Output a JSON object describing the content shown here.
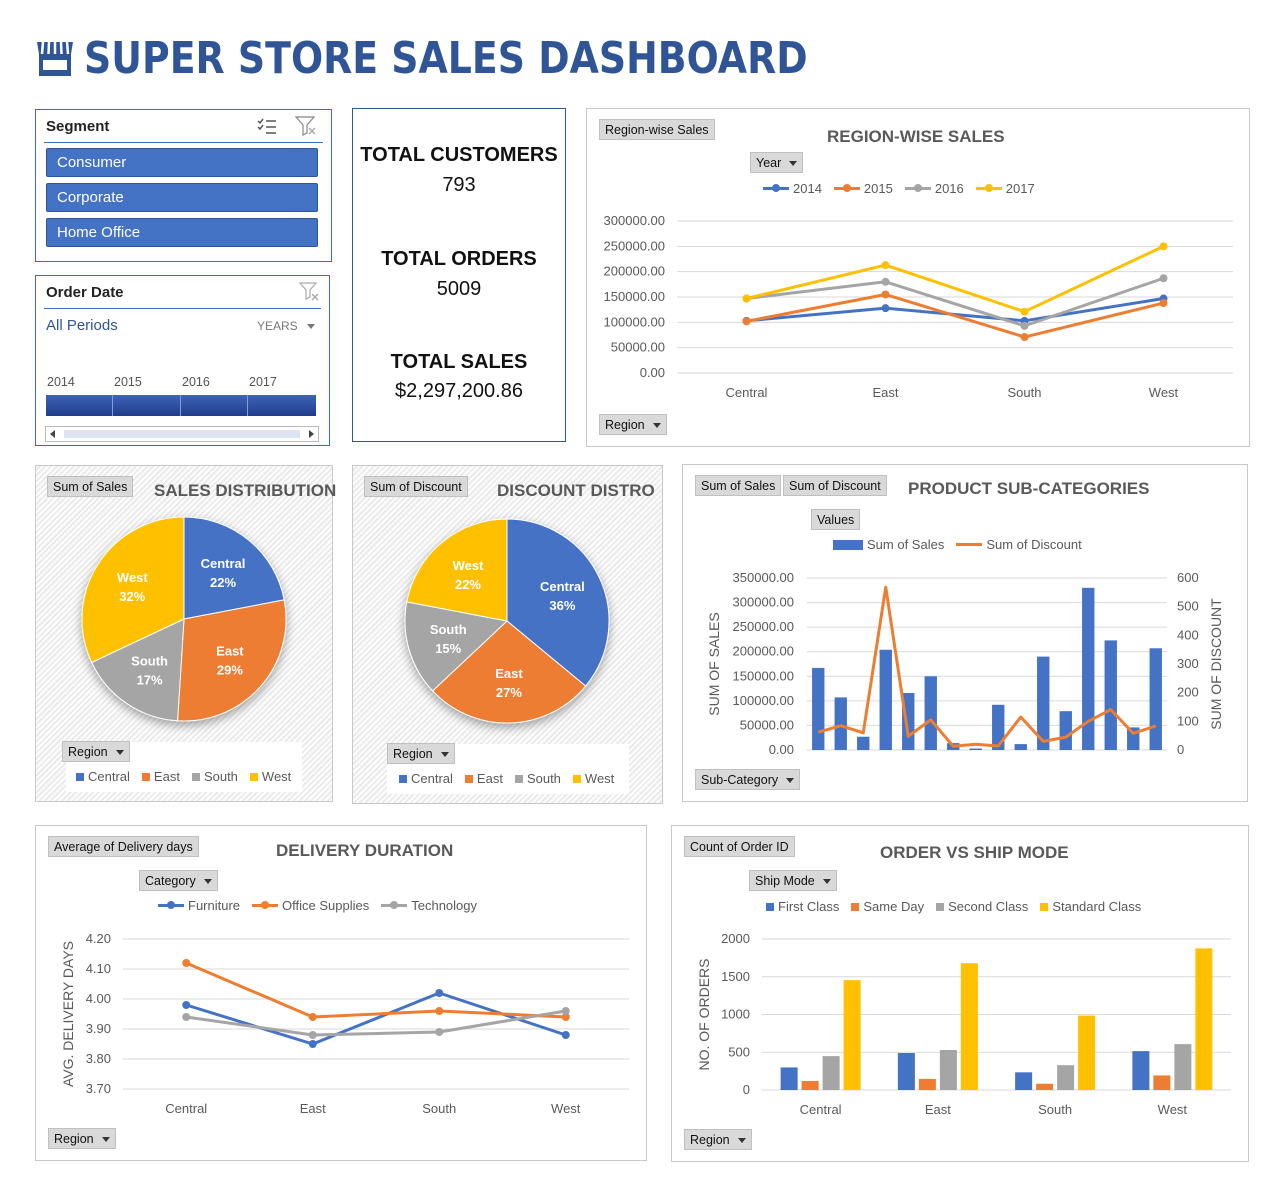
{
  "dashboard_title": "SUPER STORE SALES DASHBOARD",
  "colors": {
    "blue": "#4472c4",
    "orange": "#ed7d31",
    "gray": "#a5a5a5",
    "yellow": "#ffc000",
    "title": "#2f5597"
  },
  "segment_slicer": {
    "header": "Segment",
    "items": [
      "Consumer",
      "Corporate",
      "Home Office"
    ]
  },
  "order_date_slicer": {
    "header": "Order Date",
    "period": "All Periods",
    "level": "YEARS",
    "years": [
      "2014",
      "2015",
      "2016",
      "2017"
    ]
  },
  "kpis": {
    "customers_label": "TOTAL CUSTOMERS",
    "customers_value": "793",
    "orders_label": "TOTAL ORDERS",
    "orders_value": "5009",
    "sales_label": "TOTAL SALES",
    "sales_value": "$2,297,200.86"
  },
  "region_sales": {
    "field_value": "Region-wise Sales",
    "field_year": "Year",
    "field_region": "Region"
  },
  "sales_distribution": {
    "field_value": "Sum of Sales",
    "field_region": "Region"
  },
  "discount_distribution": {
    "field_value": "Sum of Discount",
    "field_region": "Region"
  },
  "subcategories": {
    "field_sales": "Sum of Sales",
    "field_discount": "Sum of Discount",
    "field_values": "Values",
    "field_sub": "Sub-Category"
  },
  "delivery": {
    "field_value": "Average of Delivery days",
    "field_category": "Category",
    "field_region": "Region"
  },
  "shipmode": {
    "field_value": "Count of Order ID",
    "field_ship": "Ship Mode",
    "field_region": "Region"
  },
  "chart_data": [
    {
      "id": "region",
      "type": "line",
      "title": "REGION-WISE SALES",
      "categories": [
        "Central",
        "East",
        "South",
        "West"
      ],
      "series": [
        {
          "name": "2014",
          "color": "#4472c4",
          "values": [
            103000,
            128000,
            103000,
            147000
          ]
        },
        {
          "name": "2015",
          "color": "#ed7d31",
          "values": [
            102000,
            155000,
            71000,
            138000
          ]
        },
        {
          "name": "2016",
          "color": "#a5a5a5",
          "values": [
            147000,
            180000,
            93000,
            187000
          ]
        },
        {
          "name": "2017",
          "color": "#ffc000",
          "values": [
            147000,
            213000,
            121000,
            250000
          ]
        }
      ],
      "ylim": [
        0,
        300000
      ],
      "yticks": [
        "0.00",
        "50000.00",
        "100000.00",
        "150000.00",
        "200000.00",
        "250000.00",
        "300000.00"
      ],
      "grid": true,
      "legend": "top"
    },
    {
      "id": "salesdist",
      "type": "pie",
      "title": "SALES DISTRIBUTION",
      "labels": [
        "Central",
        "East",
        "South",
        "West"
      ],
      "values": [
        22,
        29,
        17,
        32
      ],
      "value_labels": [
        "22%",
        "29%",
        "17%",
        "32%"
      ],
      "colors": [
        "#4472c4",
        "#ed7d31",
        "#a5a5a5",
        "#ffc000"
      ],
      "legend": "bottom"
    },
    {
      "id": "discdist",
      "type": "pie",
      "title": "DISCOUNT DISTRO",
      "labels": [
        "Central",
        "East",
        "South",
        "West"
      ],
      "values": [
        36,
        27,
        15,
        22
      ],
      "value_labels": [
        "36%",
        "27%",
        "15%",
        "22%"
      ],
      "colors": [
        "#4472c4",
        "#ed7d31",
        "#a5a5a5",
        "#ffc000"
      ],
      "legend": "bottom"
    },
    {
      "id": "subcat",
      "type": "bar",
      "title": "PRODUCT SUB-CATEGORIES",
      "ylabel": "SUM OF SALES",
      "y2label": "SUM OF DISCOUNT",
      "ylim": [
        0,
        350000
      ],
      "y2lim": [
        0,
        600
      ],
      "yticks": [
        "0.00",
        "50000.00",
        "100000.00",
        "150000.00",
        "200000.00",
        "250000.00",
        "300000.00",
        "350000.00"
      ],
      "y2ticks": [
        "0",
        "100",
        "200",
        "300",
        "400",
        "500",
        "600"
      ],
      "series": [
        {
          "name": "Sum of Sales",
          "color": "#4472c4",
          "kind": "bar",
          "values": [
            167000,
            107000,
            27000,
            204000,
            116000,
            150000,
            14000,
            3000,
            92000,
            12000,
            190000,
            79000,
            330000,
            223000,
            46000,
            207000
          ]
        },
        {
          "name": "Sum of Discount",
          "color": "#ed7d31",
          "kind": "line",
          "values": [
            62,
            85,
            60,
            568,
            48,
            105,
            13,
            20,
            14,
            115,
            30,
            45,
            100,
            141,
            58,
            84
          ]
        }
      ],
      "grid": true,
      "legend": "top"
    },
    {
      "id": "delivery",
      "type": "line",
      "title": "DELIVERY DURATION",
      "ylabel": "AVG. DELIVERY DAYS",
      "categories": [
        "Central",
        "East",
        "South",
        "West"
      ],
      "series": [
        {
          "name": "Furniture",
          "color": "#4472c4",
          "values": [
            3.98,
            3.85,
            4.02,
            3.88
          ]
        },
        {
          "name": "Office Supplies",
          "color": "#ed7d31",
          "values": [
            4.12,
            3.94,
            3.96,
            3.94
          ]
        },
        {
          "name": "Technology",
          "color": "#a5a5a5",
          "values": [
            3.94,
            3.88,
            3.89,
            3.96
          ]
        }
      ],
      "ylim": [
        3.7,
        4.2
      ],
      "yticks": [
        "3.70",
        "3.80",
        "3.90",
        "4.00",
        "4.10",
        "4.20"
      ],
      "grid": true,
      "legend": "top"
    },
    {
      "id": "ship",
      "type": "bar",
      "title": "ORDER VS SHIP MODE",
      "ylabel": "NO. OF ORDERS",
      "categories": [
        "Central",
        "East",
        "South",
        "West"
      ],
      "series": [
        {
          "name": "First Class",
          "color": "#4472c4",
          "values": [
            299,
            490,
            234,
            515
          ]
        },
        {
          "name": "Same Day",
          "color": "#ed7d31",
          "values": [
            120,
            147,
            83,
            193
          ]
        },
        {
          "name": "Second Class",
          "color": "#a5a5a5",
          "values": [
            449,
            530,
            329,
            608
          ]
        },
        {
          "name": "Standard Class",
          "color": "#ffc000",
          "values": [
            1455,
            1679,
            986,
            1876
          ]
        }
      ],
      "ylim": [
        0,
        2000
      ],
      "yticks": [
        "0",
        "500",
        "1000",
        "1500",
        "2000"
      ],
      "grid": true,
      "legend": "top"
    }
  ]
}
